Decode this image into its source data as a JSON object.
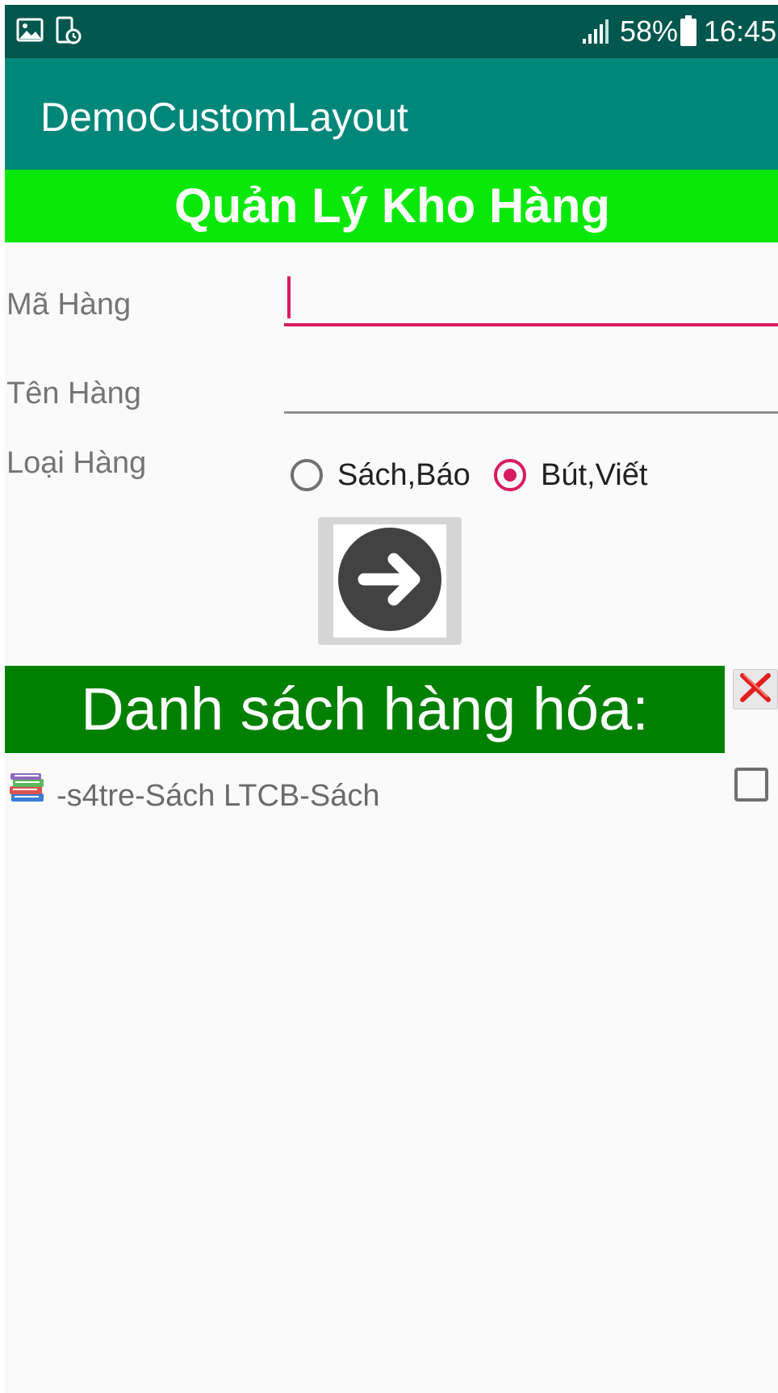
{
  "status_bar": {
    "battery_percent": "58%",
    "time": "16:45",
    "icons": [
      "image-icon",
      "screen-timer-icon",
      "signal-icon",
      "battery-icon"
    ]
  },
  "app_bar": {
    "title": "DemoCustomLayout"
  },
  "header": {
    "title": "Quản Lý Kho Hàng",
    "background": "#0ae80a"
  },
  "form": {
    "ma_hang_label": "Mã Hàng",
    "ma_hang_value": "",
    "ten_hang_label": "Tên Hàng",
    "ten_hang_value": "",
    "loai_hang_label": "Loại Hàng",
    "options": [
      {
        "label": "Sách,Báo",
        "checked": false
      },
      {
        "label": "Bút,Viết",
        "checked": true
      }
    ],
    "accent_color": "#d81b60"
  },
  "add_button": {
    "icon": "arrow-right-circle-icon"
  },
  "list": {
    "title": "Danh sách hàng hóa:",
    "background": "#008000",
    "delete_icon": "red-x-icon",
    "items": [
      {
        "icon": "books-icon",
        "text": "-s4tre-Sách LTCB-Sách",
        "checked": false
      }
    ]
  },
  "colors": {
    "status_bar": "#00574d",
    "app_bar": "#00877a"
  }
}
